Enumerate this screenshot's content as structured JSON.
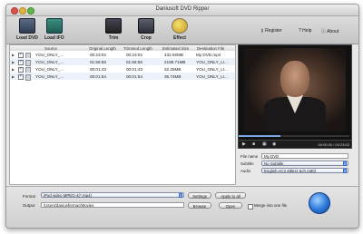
{
  "window": {
    "title": "Daniusoft DVD Ripper"
  },
  "toolbar": {
    "load_dvd": "Load DVD",
    "load_ifo": "Load IFO",
    "trim": "Trim",
    "crop": "Crop",
    "effect": "Effect",
    "register": "Register",
    "help": "Help",
    "about": "About"
  },
  "table": {
    "headers": [
      "Source",
      "Original Length",
      "Trimmed Length",
      "Estimated Size",
      "Destination File"
    ],
    "rows": [
      {
        "source": "YOU_ONLY_...",
        "original": "00:23:02",
        "trimmed": "00:23:02",
        "size": "432.92MB",
        "dest": "My DVD.mp4"
      },
      {
        "source": "YOU_ONLY_...",
        "original": "01:56:58",
        "trimmed": "01:56:58",
        "size": "2198.71MB",
        "dest": "YOU_ONLY_LI..."
      },
      {
        "source": "YOU_ONLY_...",
        "original": "00:01:43",
        "trimmed": "00:01:43",
        "size": "32.25MB",
        "dest": "YOU_ONLY_LI..."
      },
      {
        "source": "YOU_ONLY_...",
        "original": "00:01:54",
        "trimmed": "00:01:54",
        "size": "35.74MB",
        "dest": "YOU_ONLY_LI..."
      }
    ]
  },
  "player": {
    "time": "00:00:00 / 00:23:02",
    "progress": 0.38
  },
  "settings": {
    "file_name_label": "File name",
    "file_name_value": "My DVD",
    "subtitle_label": "Subtitle",
    "subtitle_value": "No Subtitle",
    "audio_label": "Audio",
    "audio_value": "English AC3 48kHz 6ch (x80)"
  },
  "bottom": {
    "format_label": "Format",
    "format_value": "iPod video MPEG-4(*.mp4)",
    "settings_btn": "Settings",
    "apply_all_btn": "Apply to all",
    "output_label": "Output",
    "output_value": "/Users/daniusfermac/Movies",
    "browse_btn": "Browse",
    "open_btn": "Open",
    "merge_label": "Merge into one file"
  }
}
